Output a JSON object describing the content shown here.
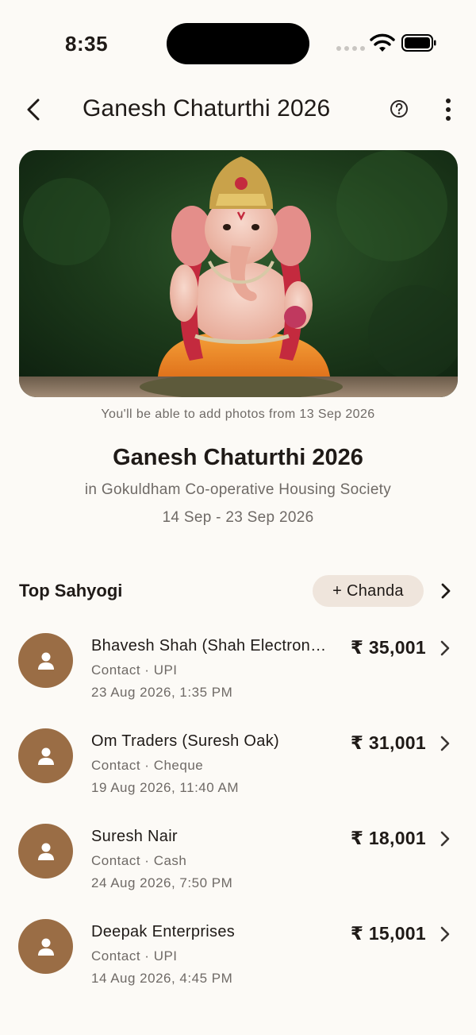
{
  "status": {
    "time": "8:35"
  },
  "header": {
    "title": "Ganesh Chaturthi 2026"
  },
  "hero": {
    "caption": "You'll be able to add photos from 13 Sep 2026"
  },
  "event": {
    "title": "Ganesh Chaturthi 2026",
    "location": "in Gokuldham Co-operative Housing Society",
    "dates": "14 Sep - 23 Sep 2026"
  },
  "section": {
    "title": "Top Sahyogi",
    "chanda_label": "+ Chanda"
  },
  "contributors": [
    {
      "name": "Bhavesh Shah (Shah Electronics)",
      "meta": "Contact · UPI",
      "date": "23 Aug 2026, 1:35 PM",
      "amount": "₹ 35,001"
    },
    {
      "name": "Om Traders (Suresh Oak)",
      "meta": "Contact · Cheque",
      "date": "19 Aug 2026, 11:40 AM",
      "amount": "₹ 31,001"
    },
    {
      "name": "Suresh Nair",
      "meta": "Contact · Cash",
      "date": "24 Aug 2026, 7:50 PM",
      "amount": "₹ 18,001"
    },
    {
      "name": "Deepak Enterprises",
      "meta": "Contact · UPI",
      "date": "14 Aug 2026, 4:45 PM",
      "amount": "₹ 15,001"
    }
  ],
  "colors": {
    "background": "#fcfaf6",
    "avatar": "#9a6d45",
    "chanda_bg": "#efe5dc",
    "muted_text": "#6f6a66"
  },
  "icons": [
    "back-arrow-icon",
    "help-circle-icon",
    "more-vertical-icon",
    "chevron-right-icon",
    "person-icon",
    "wifi-icon",
    "battery-icon"
  ]
}
